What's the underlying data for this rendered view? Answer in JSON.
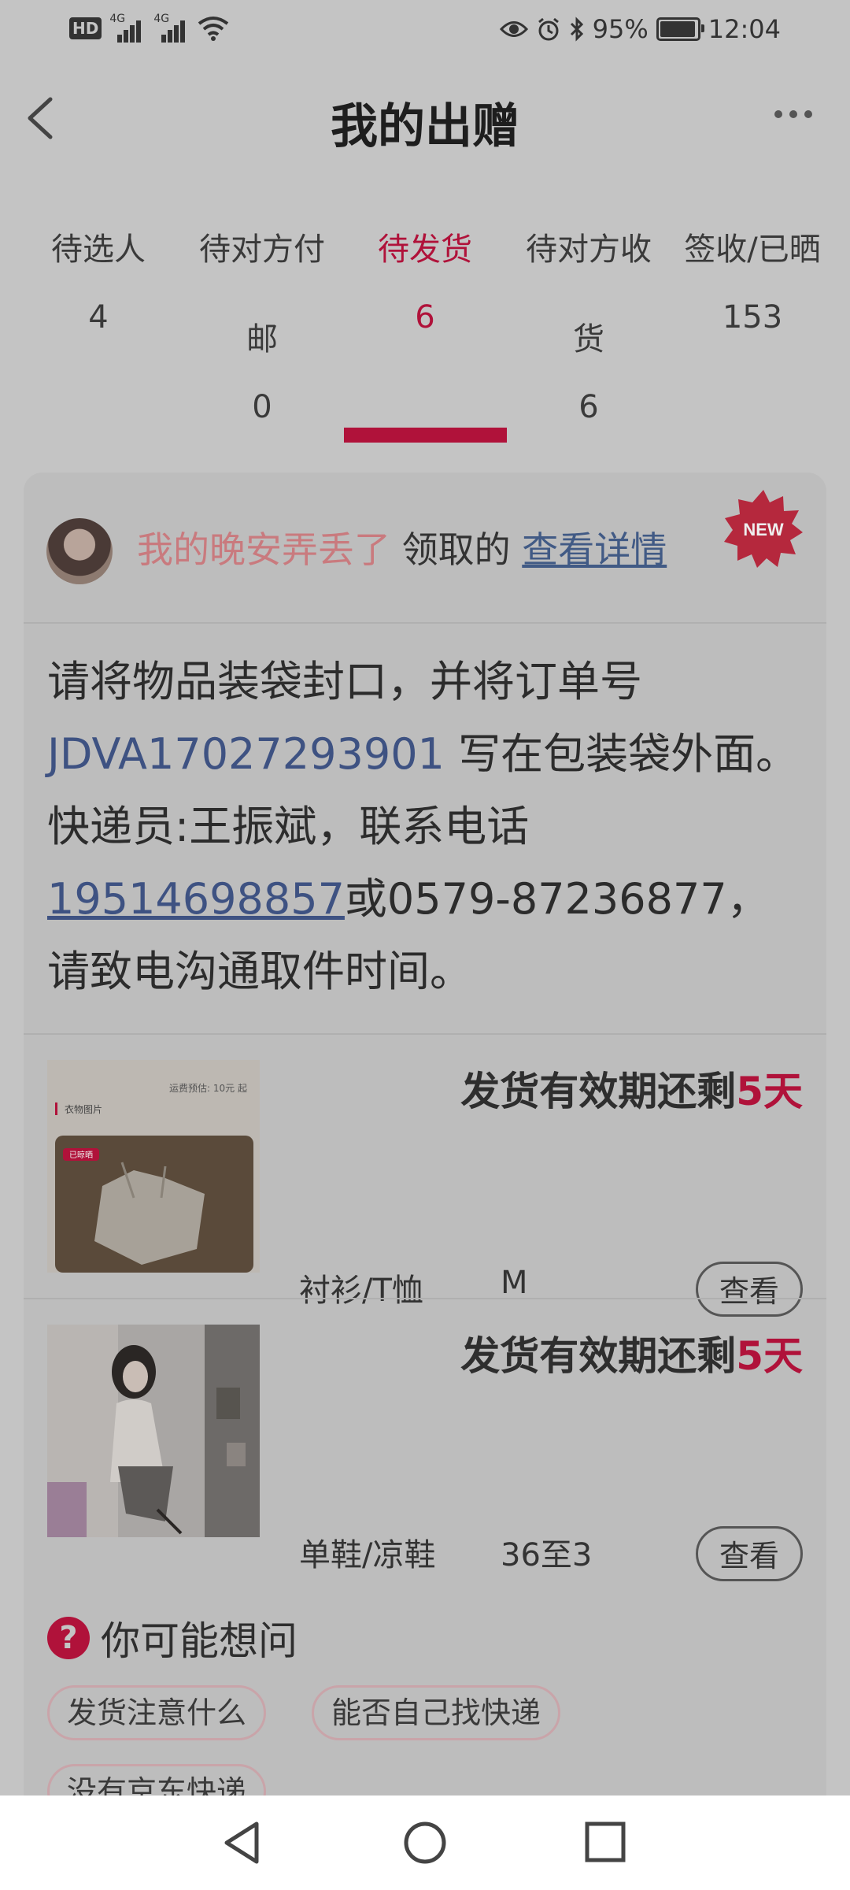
{
  "status_bar": {
    "network_left": [
      "HD",
      "4G",
      "4G"
    ],
    "battery": "95%",
    "time": "12:04",
    "icons": [
      "hd-icon",
      "signal-icon",
      "signal-icon",
      "wifi-icon",
      "eye-icon",
      "alarm-icon",
      "bluetooth-icon",
      "battery-icon"
    ]
  },
  "header": {
    "title": "我的出赠",
    "back_icon": "chevron-left-icon",
    "more_icon": "more-dots-icon"
  },
  "tabs": [
    {
      "label": "待选人",
      "count": "4"
    },
    {
      "label": "待对方付",
      "wrap": "邮",
      "count": "0"
    },
    {
      "label": "待发货",
      "count": "6",
      "active": true
    },
    {
      "label": "待对方收",
      "wrap": "货",
      "count": "6"
    },
    {
      "label": "签收/已晒",
      "count": "153"
    }
  ],
  "claim": {
    "user": "我的晚安弄丢了",
    "text": "领取的",
    "link": "查看详情",
    "badge": "NEW"
  },
  "instructions": {
    "p1": "请将物品装袋封口，并将订单号 ",
    "order_no": "JDVA17027293901",
    "p2": " 写在包装袋外面。快递员:王振斌，联系电话",
    "phone": "19514698857",
    "p3": "或0579-87236877，请致电沟通取件时间。"
  },
  "items": [
    {
      "deadline_prefix": "发货有效期还剩",
      "days": "5天",
      "category": "衬衫/T恤",
      "size": "M",
      "view": "查看",
      "thumb_text": {
        "estimate": "运费预估: 10元 起",
        "section": "衣物图片",
        "tag": "已晾晒"
      }
    },
    {
      "deadline_prefix": "发货有效期还剩",
      "days": "5天",
      "category": "单鞋/凉鞋",
      "size": "36至3",
      "view": "查看"
    }
  ],
  "faq": {
    "title": "你可能想问",
    "chips": [
      "发货注意什么",
      "能否自己找快递",
      "没有京东快递"
    ]
  },
  "colors": {
    "accent": "#b0123a",
    "link": "#3e5282",
    "overlay_bg": "#c4c4c4"
  }
}
